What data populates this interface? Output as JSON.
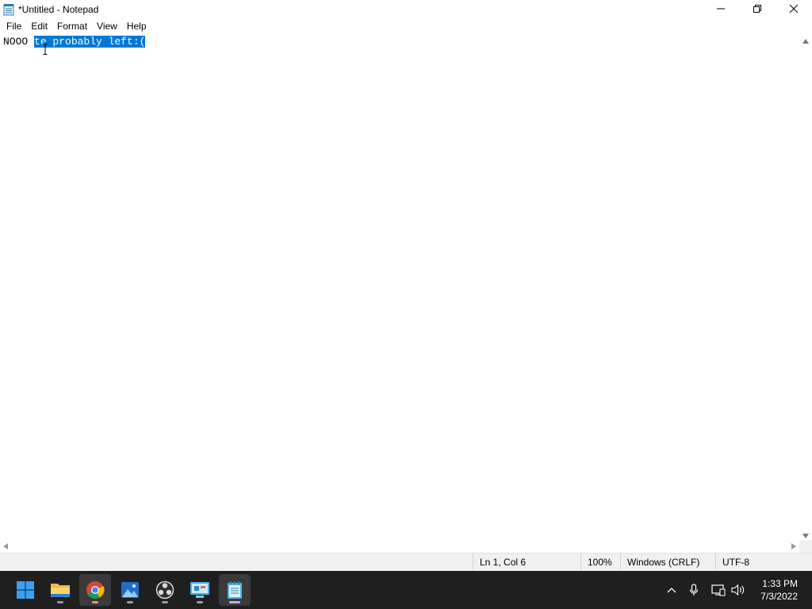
{
  "window": {
    "title": "*Untitled - Notepad",
    "icon": "notepad-icon"
  },
  "window_controls": {
    "minimize": "minimize-icon",
    "maximize": "restore-icon",
    "close": "close-icon"
  },
  "menu": {
    "items": [
      "File",
      "Edit",
      "Format",
      "View",
      "Help"
    ]
  },
  "editor": {
    "text_before_selection": "NOOO ",
    "selected_text": "te probably left:(",
    "selection_color": "#0078d7"
  },
  "status": {
    "position": "Ln 1, Col 6",
    "zoom": "100%",
    "line_ending": "Windows (CRLF)",
    "encoding": "UTF-8"
  },
  "taskbar": {
    "apps": [
      "start-icon",
      "file-explorer-icon",
      "chrome-icon",
      "photos-icon",
      "obs-icon",
      "control-panel-icon",
      "notepad-icon"
    ],
    "tray_icons": [
      "chevron-up-icon",
      "microphone-icon",
      "network-icon",
      "volume-icon"
    ],
    "time": "1:33 PM",
    "date": "7/3/2022"
  },
  "colors": {
    "taskbar_bg": "#1f1f1f",
    "accent": "#0078d7",
    "active_indicator": "#c6a6f5"
  }
}
